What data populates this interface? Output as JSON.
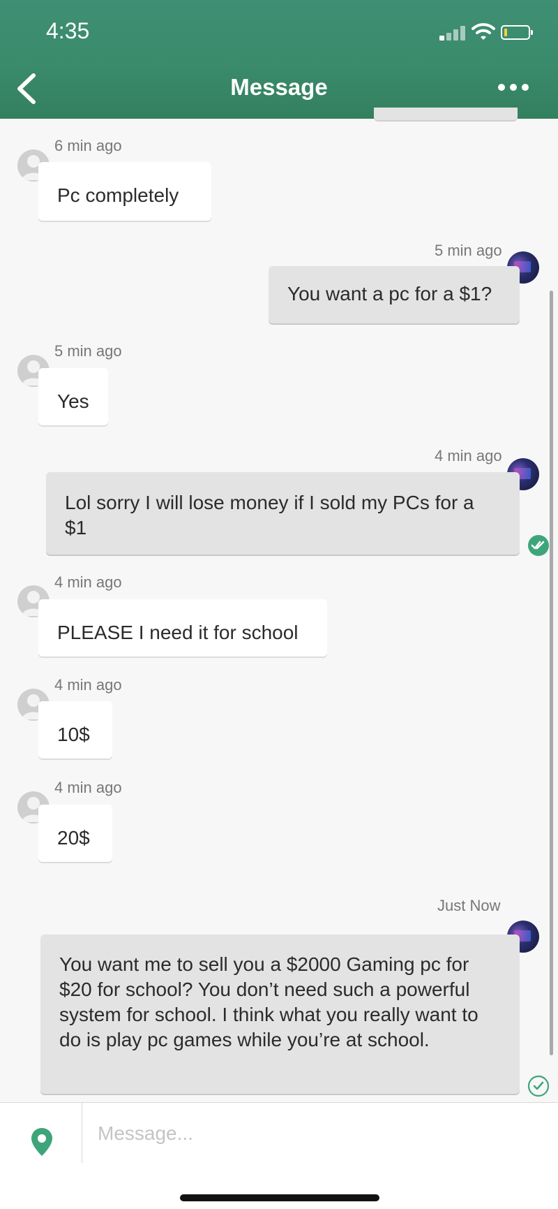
{
  "status_bar": {
    "time": "4:35"
  },
  "header": {
    "title": "Message"
  },
  "messages": [
    {
      "side": "in",
      "time": "6 min ago",
      "text": "Pc completely"
    },
    {
      "side": "out",
      "time": "5 min ago",
      "text": "You want a pc for a $1?"
    },
    {
      "side": "in",
      "time": "5 min ago",
      "text": "Yes"
    },
    {
      "side": "out",
      "time": "4 min ago",
      "text": "Lol sorry I will lose money if I sold my PCs for a $1",
      "read": true
    },
    {
      "side": "in",
      "time": "4 min ago",
      "text": "PLEASE I need it for school"
    },
    {
      "side": "in",
      "time": "4 min ago",
      "text": "10$"
    },
    {
      "side": "in",
      "time": "4 min ago",
      "text": "20$"
    },
    {
      "side": "out",
      "time": "Just Now",
      "text": "You want me to sell you a $2000 Gaming pc for $20 for school? You don’t need such a powerful system for school. I think what you really want to do is play pc games while you’re at school.",
      "read": false
    }
  ],
  "composer": {
    "placeholder": "Message..."
  },
  "colors": {
    "header": "#3a8a6c",
    "read_check": "#3ea57b",
    "incoming_bubble": "#ffffff",
    "outgoing_bubble": "#e3e3e3"
  }
}
